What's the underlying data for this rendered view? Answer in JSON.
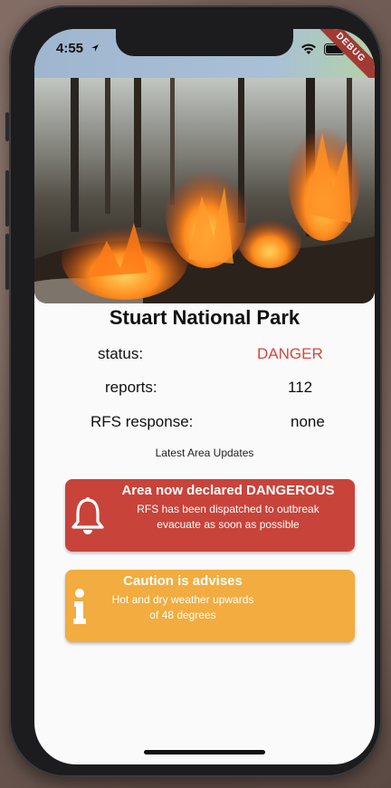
{
  "status_bar": {
    "time": "4:55",
    "debug_label": "DEBUG"
  },
  "park": {
    "name": "Stuart National Park",
    "status_label": "status:",
    "status_value": "DANGER",
    "reports_label": "reports:",
    "reports_value": "112",
    "rfs_label": "RFS response:",
    "rfs_value": "none"
  },
  "updates": {
    "title": "Latest Area Updates",
    "cards": [
      {
        "icon": "bell-icon",
        "title": "Area now declared DANGEROUS",
        "line1": "RFS has been dispatched to outbreak",
        "line2": "evacuate as soon as possible",
        "color": "#c8433a"
      },
      {
        "icon": "info-icon",
        "title": "Caution is advises",
        "line1": "Hot and dry weather upwards",
        "line2": "of 48 degrees",
        "color": "#f2ac3f"
      }
    ]
  },
  "colors": {
    "danger": "#d9463c"
  }
}
